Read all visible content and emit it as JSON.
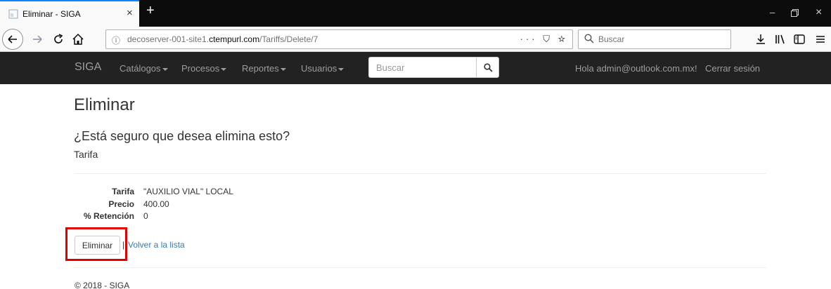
{
  "browser": {
    "tab_title": "Eliminar - SIGA",
    "new_tab": "+",
    "url_prefix": "decoserver-001-site1.",
    "url_domain": "ctempurl.com",
    "url_path": "/Tariffs/Delete/7",
    "url_actions": "··· ⛉ ☆",
    "search_placeholder": "Buscar",
    "icons": [
      "back-icon",
      "forward-icon",
      "reload-icon",
      "home-icon",
      "info-icon",
      "page-actions-icon",
      "pocket-icon",
      "bookmark-star-icon",
      "search-icon",
      "download-icon",
      "library-icon",
      "sidebar-icon",
      "menu-icon",
      "minimize-icon",
      "restore-icon",
      "close-icon"
    ]
  },
  "site_nav": {
    "brand": "SIGA",
    "items": [
      {
        "label": "Catálogos"
      },
      {
        "label": "Procesos"
      },
      {
        "label": "Reportes"
      },
      {
        "label": "Usuarios"
      }
    ],
    "search_placeholder": "Buscar",
    "greeting": "Hola admin@outlook.com.mx!",
    "logout": "Cerrar sesión"
  },
  "main": {
    "title": "Eliminar",
    "question": "¿Está seguro que desea elimina esto?",
    "entity": "Tarifa",
    "details": [
      {
        "label": "Tarifa",
        "value": "\"AUXILIO VIAL\" LOCAL"
      },
      {
        "label": "Precio",
        "value": "400.00"
      },
      {
        "label": "% Retención",
        "value": "0"
      }
    ],
    "delete_button": "Eliminar",
    "separator": "|",
    "back_link": "Volver a la lista"
  },
  "footer": {
    "text": "© 2018 - SIGA"
  },
  "colors": {
    "navbar_bg": "#222222",
    "nav_text": "#9d9d9d",
    "link": "#337ab7",
    "highlight": "#e00000"
  }
}
